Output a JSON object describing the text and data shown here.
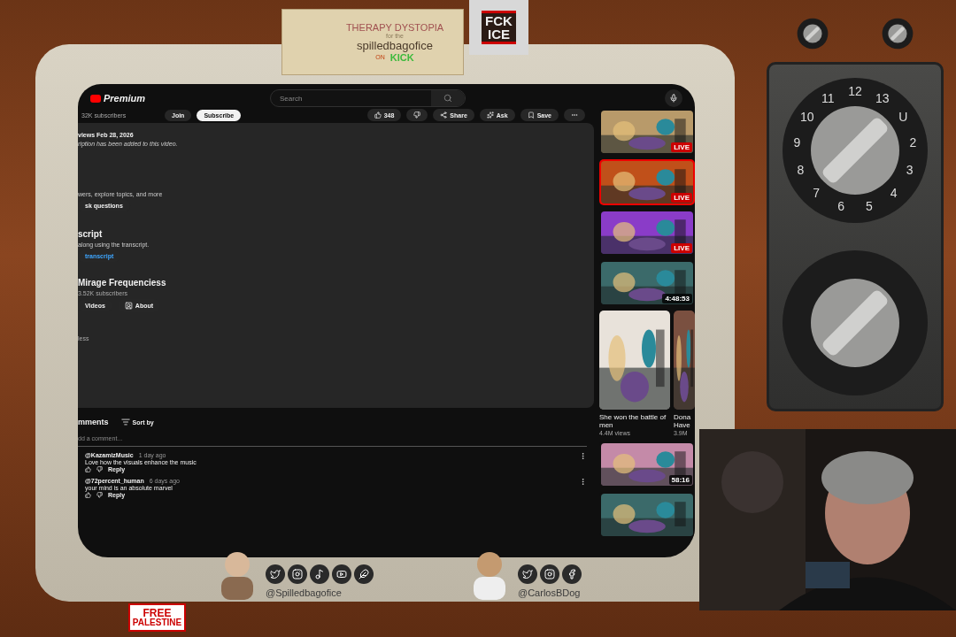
{
  "banner": {
    "title": "THERAPY DYSTOPIA",
    "sub": "for the",
    "name": "spilledbagofice",
    "on": "ON",
    "platform": "KICK"
  },
  "badge": {
    "lines": [
      "FCK",
      "ICE"
    ]
  },
  "youtube": {
    "logo": "Premium",
    "search": {
      "placeholder": "Search"
    },
    "header": {
      "subscribers": "32K subscribers",
      "join": "Join",
      "subscribe": "Subscribe",
      "like_count": "348",
      "share": "Share",
      "ask": "Ask",
      "save": "Save"
    },
    "description": {
      "meta": "views  Feb 28, 2026",
      "note": "ription has been added to this video.",
      "ai_text": "wers, explore topics, and more",
      "ask_button": "sk questions",
      "transcript_heading": "script",
      "transcript_text": "along using the transcript.",
      "transcript_button": "transcript",
      "channel": "Mirage Frequenciess",
      "channel_subscribers": "3.52K subscribers",
      "channel_buttons": [
        "Videos",
        "About"
      ],
      "less": "less"
    },
    "comments": {
      "heading": "mments",
      "sort": "Sort by",
      "placeholder": "dd a comment...",
      "items": [
        {
          "author": "@KazamizMusic",
          "time": "1 day ago",
          "text": "Love how the visuals enhance the music",
          "reply": "Reply"
        },
        {
          "author": "@72percent_human",
          "time": "6 days ago",
          "text": "your mind is an absolute marvel",
          "reply": "Reply"
        }
      ]
    },
    "related": [
      {
        "kind": "live",
        "badge": "LIVE",
        "selected": false
      },
      {
        "kind": "live",
        "badge": "LIVE",
        "selected": true
      },
      {
        "kind": "live",
        "badge": "LIVE",
        "selected": false
      },
      {
        "kind": "duration",
        "badge": "4:48:53",
        "selected": false
      },
      {
        "kind": "shorts",
        "shorts": [
          {
            "title": "She won the battle of men",
            "views": "4.4M views"
          },
          {
            "title": "Dona Have",
            "views": "3.9M"
          }
        ]
      },
      {
        "kind": "duration",
        "badge": "58:16",
        "selected": false
      },
      {
        "kind": "plain",
        "selected": false
      }
    ]
  },
  "socials": [
    {
      "handle": "@Spilledbagofice",
      "icons": [
        {
          "kind": "twitter"
        },
        {
          "kind": "instagram"
        },
        {
          "kind": "tiktok"
        },
        {
          "kind": "youtube"
        },
        {
          "kind": "bluesky"
        }
      ]
    },
    {
      "handle": "@CarlosBDog",
      "icons": [
        {
          "kind": "twitter"
        },
        {
          "kind": "instagram"
        },
        {
          "kind": "facebook"
        }
      ]
    }
  ],
  "dial": {
    "numbers": [
      "12",
      "13",
      "U",
      "2",
      "3",
      "4",
      "5",
      "6",
      "7",
      "8",
      "9",
      "10",
      "11"
    ]
  },
  "flag_badge": {
    "lines": [
      "FREE",
      "PALESTINE"
    ]
  }
}
